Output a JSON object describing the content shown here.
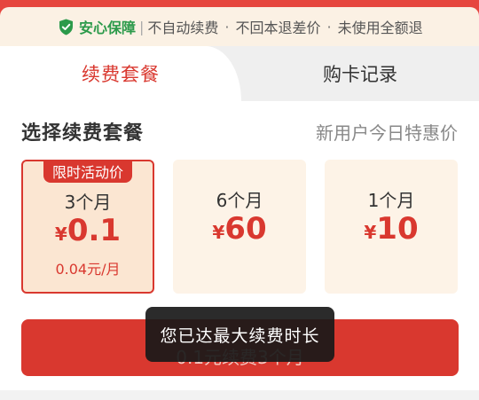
{
  "guarantee": {
    "title": "安心保障",
    "separator": "|",
    "items": [
      "不自动续费",
      "不回本退差价",
      "未使用全额退"
    ],
    "dot": "·"
  },
  "tabs": [
    {
      "label": "续费套餐",
      "active": true
    },
    {
      "label": "购卡记录",
      "active": false
    }
  ],
  "section": {
    "title": "选择续费套餐",
    "subtitle": "新用户今日特惠价"
  },
  "plans": [
    {
      "badge": "限时活动价",
      "period": "3个月",
      "currency": "¥",
      "price": "0.1",
      "unit_price": "0.04元/月",
      "selected": true
    },
    {
      "period": "6个月",
      "currency": "¥",
      "price": "60",
      "selected": false
    },
    {
      "period": "1个月",
      "currency": "¥",
      "price": "10",
      "selected": false
    }
  ],
  "buy_button": {
    "label": "0.1元续费3个月"
  },
  "toast": {
    "message": "您已达最大续费时长"
  },
  "colors": {
    "accent": "#d9382f",
    "guarantee_green": "#2b9a4a",
    "card_bg": "#fdf3e7"
  },
  "icons": {
    "guarantee": "shield-check-icon"
  }
}
